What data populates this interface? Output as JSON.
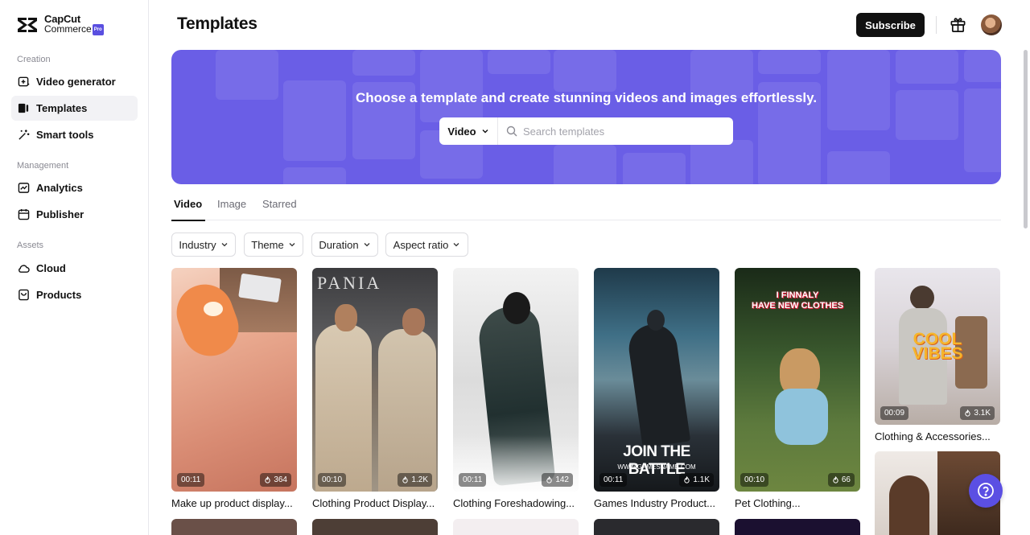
{
  "brand": {
    "name_line1": "CapCut",
    "name_line2": "Commerce",
    "badge": "Pro"
  },
  "sidebar": {
    "sections": [
      {
        "label": "Creation",
        "items": [
          {
            "label": "Video generator",
            "icon": "video-plus-icon"
          },
          {
            "label": "Templates",
            "icon": "templates-icon",
            "active": true
          },
          {
            "label": "Smart tools",
            "icon": "magic-wand-icon"
          }
        ]
      },
      {
        "label": "Management",
        "items": [
          {
            "label": "Analytics",
            "icon": "analytics-icon"
          },
          {
            "label": "Publisher",
            "icon": "calendar-icon"
          }
        ]
      },
      {
        "label": "Assets",
        "items": [
          {
            "label": "Cloud",
            "icon": "cloud-icon"
          },
          {
            "label": "Products",
            "icon": "products-icon"
          }
        ]
      }
    ]
  },
  "header": {
    "title": "Templates",
    "subscribe_label": "Subscribe"
  },
  "hero": {
    "headline": "Choose a template and create stunning videos and images effortlessly.",
    "search_type": "Video",
    "search_placeholder": "Search templates"
  },
  "tabs": [
    {
      "label": "Video",
      "active": true
    },
    {
      "label": "Image"
    },
    {
      "label": "Starred"
    }
  ],
  "filters": [
    "Industry",
    "Theme",
    "Duration",
    "Aspect ratio"
  ],
  "templates": [
    {
      "title": "Make up product display...",
      "duration": "00:11",
      "uses": "364"
    },
    {
      "title": "Clothing Product Display...",
      "duration": "00:10",
      "uses": "1.2K"
    },
    {
      "title": "Clothing Foreshadowing...",
      "duration": "00:11",
      "uses": "142"
    },
    {
      "title": "Games Industry Product...",
      "duration": "00:11",
      "uses": "1.1K",
      "overlay_main": "JOIN THE BATTLE",
      "overlay_sub": "WWW.GAMESNAME.COM"
    },
    {
      "title": "Pet Clothing...",
      "duration": "00:10",
      "uses": "66",
      "overlay_line1": "I FINNALY",
      "overlay_line2": "HAVE NEW CLOTHES"
    },
    {
      "title": "Clothing & Accessories...",
      "duration": "00:09",
      "uses": "3.1K",
      "overlay_line1": "COOL",
      "overlay_line2": "VIBES"
    }
  ],
  "colors": {
    "accent": "#6a5ee6",
    "primary_button": "#111111"
  }
}
